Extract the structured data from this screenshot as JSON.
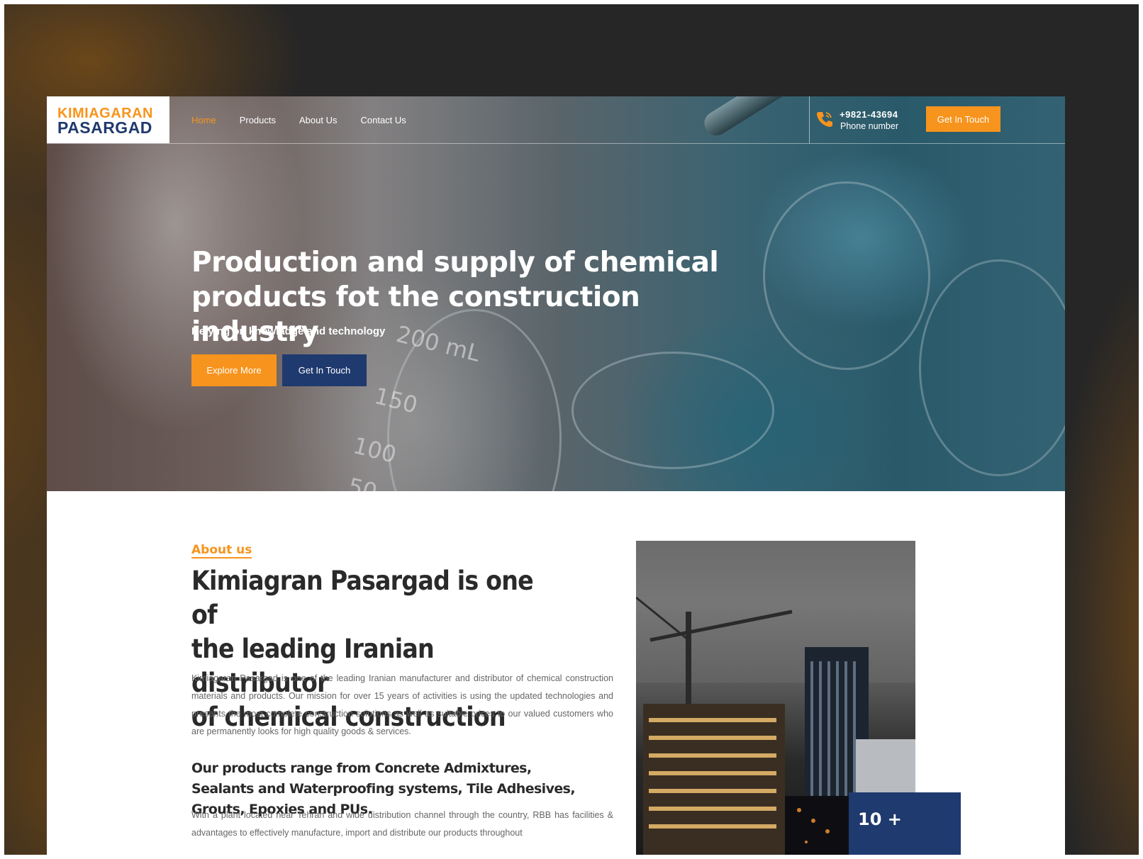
{
  "header": {
    "logo_top": "KIMIAGARAN",
    "logo_bottom": "PASARGAD",
    "nav": [
      {
        "label": "Home",
        "active": true
      },
      {
        "label": "Products",
        "active": false
      },
      {
        "label": "About Us",
        "active": false
      },
      {
        "label": "Contact Us",
        "active": false
      }
    ],
    "phone_number": "+9821-43694",
    "phone_label": "Phone number",
    "cta_label": "Get In Touch"
  },
  "hero": {
    "title_line1": "Production and supply of chemical",
    "title_line2": "products fot the construction industry",
    "subtitle": "Relying on knowladge and technology",
    "primary_button": "Explore More",
    "secondary_button": "Get In Touch"
  },
  "about": {
    "section_label": "About us",
    "title_lines": [
      "Kimiagran Pasargad is one of",
      "the leading Iranian distributor",
      "of chemical construction"
    ],
    "paragraph1": "Kimiagaran Pasargad is one of the leading Iranian manufacturer and distributor of chemical construction materials and products. Our mission for over 15 years of activities is using the updated technologies and presents the most complete construction solutions as well as suitable prices to our valued customers who are permanently looks for high quality goods & services.",
    "subheading": "Our products range from Concrete Admixtures, Sealants and Waterproofing systems, Tile Adhesives, Grouts, Epoxies and PUs.",
    "paragraph2": "With a plant located near Tehran and wide distribution channel through the country, RBB has facilities & advantages to effectively manufacture, import and distribute our products throughout",
    "stat_value": "10 +"
  },
  "colors": {
    "accent": "#f7941d",
    "navy": "#1f3a6e",
    "page_bg": "#262626"
  },
  "icons": {
    "phone": "phone-icon"
  }
}
